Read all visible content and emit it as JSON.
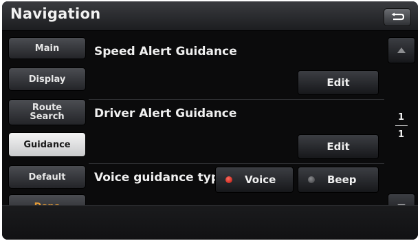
{
  "header": {
    "title": "Navigation",
    "back_icon": "return-arrow-icon"
  },
  "sidebar": {
    "items": [
      {
        "label": "Main",
        "active": false
      },
      {
        "label": "Display",
        "active": false
      },
      {
        "label": "Route Search",
        "active": false
      },
      {
        "label": "Guidance",
        "active": true
      },
      {
        "label": "Default",
        "active": false
      },
      {
        "label": "Done",
        "active": false,
        "color": "#e39a36"
      }
    ]
  },
  "settings": {
    "speed_alert": {
      "label": "Speed Alert Guidance",
      "button": "Edit"
    },
    "driver_alert": {
      "label": "Driver Alert Guidance",
      "button": "Edit"
    },
    "voice_type": {
      "label": "Voice guidance type",
      "options": [
        {
          "label": "Voice",
          "selected": true
        },
        {
          "label": "Beep",
          "selected": false
        }
      ]
    }
  },
  "pager": {
    "current": "1",
    "total": "1",
    "up_icon": "triangle-up-icon",
    "down_icon": "triangle-down-icon"
  },
  "colors": {
    "accent_selected": "#d4231a",
    "done_text": "#e39a36"
  }
}
